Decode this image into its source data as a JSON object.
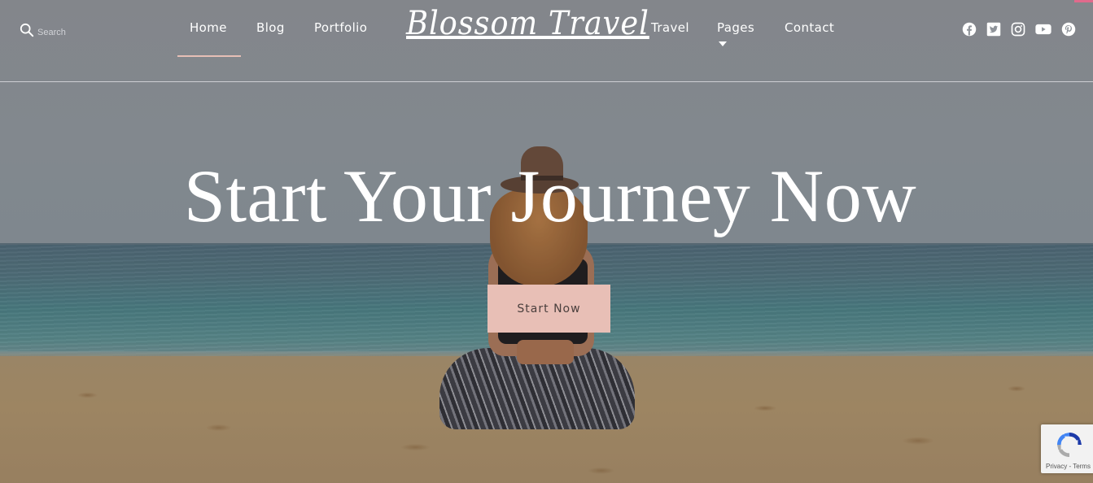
{
  "header": {
    "search": {
      "placeholder": "Search",
      "value": ""
    },
    "logo": "Blossom Travel",
    "nav_left": [
      {
        "label": "Home",
        "active": true
      },
      {
        "label": "Blog"
      },
      {
        "label": "Portfolio"
      }
    ],
    "nav_right": [
      {
        "label": "Travel"
      },
      {
        "label": "Pages",
        "has_dropdown": true
      },
      {
        "label": "Contact"
      }
    ],
    "social": [
      "facebook-icon",
      "twitter-icon",
      "instagram-icon",
      "youtube-icon",
      "pinterest-icon"
    ]
  },
  "hero": {
    "title": "Start Your Journey Now",
    "cta_label": "Start Now"
  },
  "recaptcha": {
    "links": "Privacy - Terms"
  },
  "colors": {
    "accent": "#e8bfb6",
    "active_underline": "#e6bfb6",
    "cta_text": "#4a3f3d",
    "top_strip": "#e06a8c"
  }
}
